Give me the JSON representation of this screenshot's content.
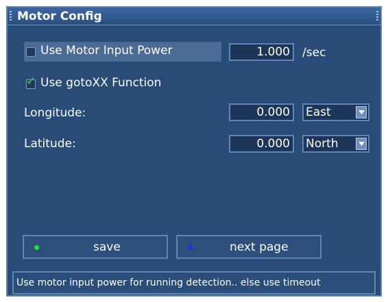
{
  "window": {
    "title": "Motor Config"
  },
  "rows": {
    "motor_input_power": {
      "label": "Use Motor Input Power",
      "checked": false,
      "value": "1.000",
      "unit": "/sec"
    },
    "gotoxx": {
      "label": "Use gotoXX Function",
      "checked": true
    },
    "longitude": {
      "label": "Longitude:",
      "value": "0.000",
      "direction": "East"
    },
    "latitude": {
      "label": "Latitude:",
      "value": "0.000",
      "direction": "North"
    }
  },
  "buttons": {
    "save": {
      "label": "save",
      "dot_color": "#2ee03a"
    },
    "next_page": {
      "label": "next page",
      "dot_color": "#1a35e8"
    }
  },
  "status": {
    "text": "Use motor input power for running detection.. else use timeout"
  },
  "icons": {
    "checkmark": "✓",
    "dropdown": "chevron-down-icon"
  },
  "colors": {
    "background": "#284b77",
    "border": "#5f86b6",
    "highlight": "#4b6a95",
    "check_green": "#39d33f"
  }
}
